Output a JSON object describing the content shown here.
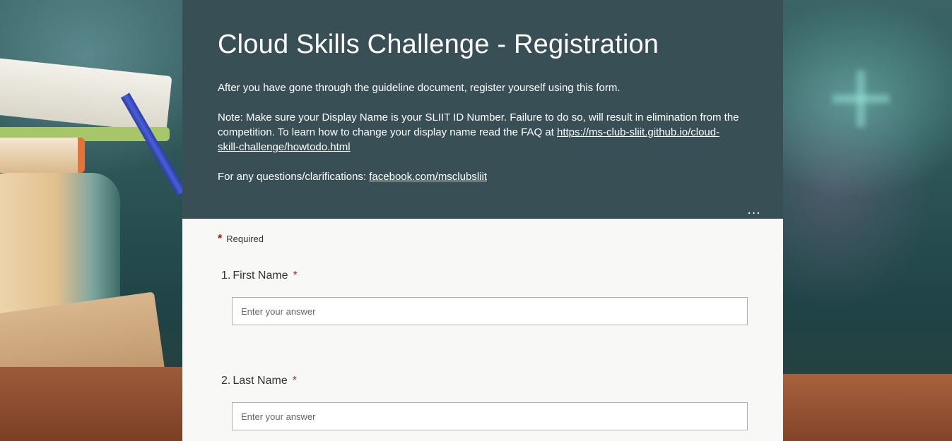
{
  "form": {
    "title": "Cloud Skills Challenge - Registration",
    "description": {
      "paragraph1": "After you have gone through the guideline document, register yourself using this form.",
      "paragraph2_text": "Note: Make sure your Display Name is your SLIIT ID Number. Failure to do so, will result in elimination from the competition. To learn how to change your display name read the FAQ at ",
      "paragraph2_link": "https://ms-club-sliit.github.io/cloud-skill-challenge/howtodo.html",
      "paragraph3_text": "For any questions/clarifications: ",
      "paragraph3_link": "facebook.com/msclubsliit"
    },
    "more_button": "…",
    "required_marker": "*",
    "required_label": "Required",
    "questions": [
      {
        "number": "1.",
        "label": "First Name",
        "required_mark": "*",
        "placeholder": "Enter your answer"
      },
      {
        "number": "2.",
        "label": "Last Name",
        "required_mark": "*",
        "placeholder": "Enter your answer"
      }
    ]
  },
  "colors": {
    "header_bg": "#374f55",
    "required_star": "#c00000",
    "card_bg": "#f8f8f7"
  }
}
